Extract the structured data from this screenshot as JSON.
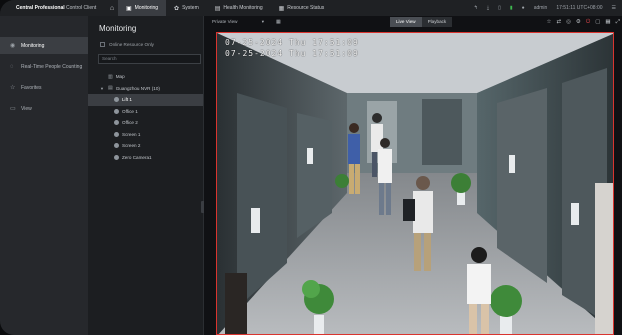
{
  "topbar": {
    "brand_bold": "Central Professional",
    "brand_rest": "Control Client",
    "tabs": [
      {
        "label": "Monitoring",
        "icon": "camera-icon"
      },
      {
        "label": "System",
        "icon": "gear-icon"
      },
      {
        "label": "Health Monitoring",
        "icon": "health-icon"
      },
      {
        "label": "Resource Status",
        "icon": "resource-icon"
      }
    ],
    "user": "admin",
    "time": "17:51:11 UTC+08:00"
  },
  "leftnav": {
    "items": [
      {
        "label": "Monitoring",
        "icon": "monitor-icon"
      },
      {
        "label": "Real-Time People Counting",
        "icon": "people-icon"
      },
      {
        "label": "Favorites",
        "icon": "star-icon"
      },
      {
        "label": "View",
        "icon": "view-icon"
      }
    ]
  },
  "tree": {
    "title": "Monitoring",
    "online_only": "Online Resource Only",
    "search_placeholder": "Search",
    "map": "Map",
    "group": "Guangzhou NVR (10)",
    "cameras": [
      "Lift 1",
      "Office 1",
      "Office 2",
      "Screen 1",
      "Screen 2",
      "Zero Camera1"
    ]
  },
  "view": {
    "dropdown": "Private View",
    "segments": {
      "live": "Live View",
      "playback": "Playback"
    },
    "osd_line1": "07-25-2024 Thu 17:51:09",
    "osd_line2": "07-25-2024 Thu 17:51:09"
  },
  "colors": {
    "accent": "#d9342f",
    "status": "#3fb950",
    "selected": "#3b3e43"
  }
}
